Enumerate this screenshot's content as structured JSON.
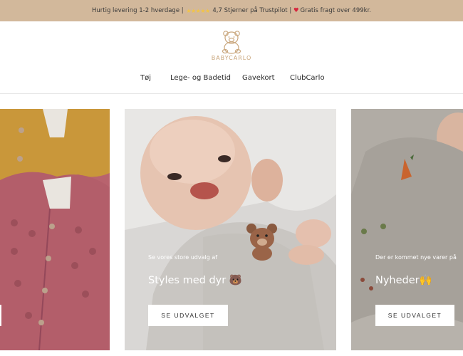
{
  "announcement": {
    "delivery": "Hurtig levering 1-2 hverdage |",
    "stars": "★★★★★",
    "rating": "4,7 Stjerner på Trustpilot |",
    "heart": "♥",
    "shipping": "Gratis fragt over 499kr."
  },
  "logo": {
    "text": "BABYCARLO"
  },
  "nav": {
    "items": [
      {
        "label": "Tøj"
      },
      {
        "label": "Lege- og Badetid"
      },
      {
        "label": "Gavekort"
      },
      {
        "label": "ClubCarlo"
      }
    ]
  },
  "cards": [
    {
      "subtitle": "",
      "title": "",
      "button": ""
    },
    {
      "subtitle": "Se vores store udvalg af",
      "title": "Styles med dyr 🐻",
      "button": "SE UDVALGET"
    },
    {
      "subtitle": "Der er kommet nye varer på",
      "title": "Nyheder🙌",
      "button": "SE UDVALGET"
    }
  ],
  "colors": {
    "announcement_bg": "#d2b89b",
    "logo_gold": "#c9a67c",
    "button_bg": "#ffffff"
  },
  "icons": [
    "star-icon",
    "heart-icon",
    "teddy-bear-logo-icon"
  ]
}
